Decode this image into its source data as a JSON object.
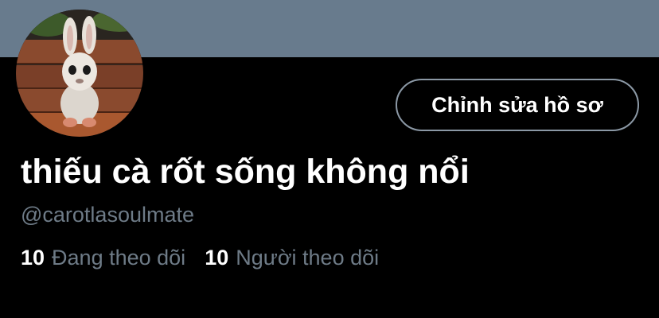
{
  "colors": {
    "background": "#000000",
    "banner": "#687b8d",
    "primary_text": "#ffffff",
    "secondary_text": "#6e7b87",
    "button_border": "#8b98a5"
  },
  "profile": {
    "avatar_icon": "rabbid-avatar",
    "edit_button_label": "Chỉnh sửa hồ sơ",
    "display_name": "thiếu cà rốt sống không nổi",
    "handle": "@carotlasoulmate",
    "following_count": "10",
    "following_label": "Đang theo dõi",
    "followers_count": "10",
    "followers_label": "Người theo dõi"
  }
}
